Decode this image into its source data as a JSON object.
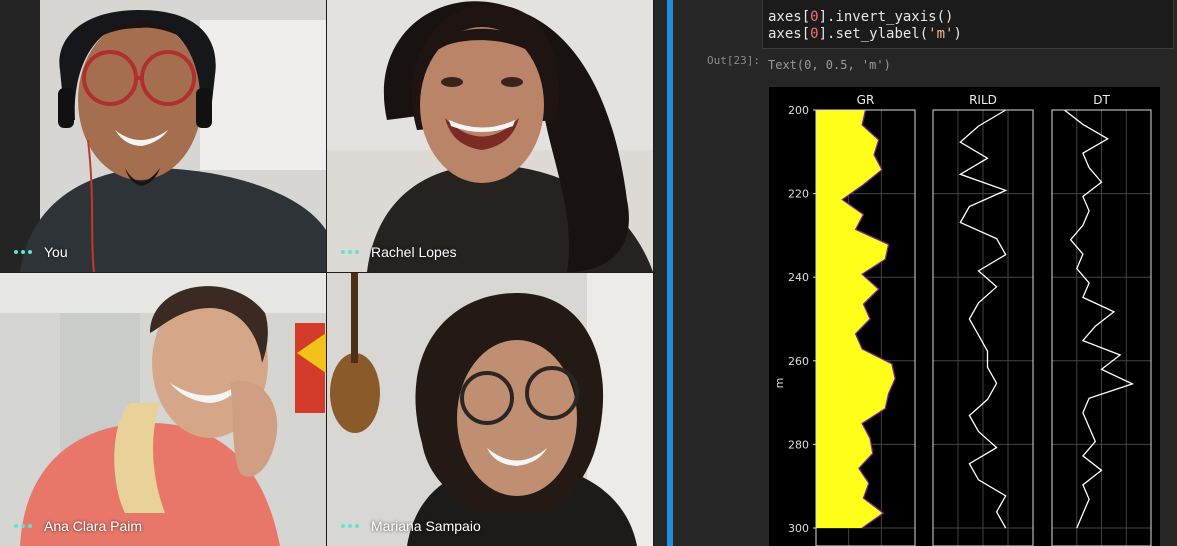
{
  "participants": [
    {
      "name": "You"
    },
    {
      "name": "Rachel Lopes"
    },
    {
      "name": "Ana Clara Paim"
    },
    {
      "name": "Mariana Sampaio"
    }
  ],
  "notebook": {
    "code_lines": [
      {
        "pre": "axes[",
        "num": "0",
        "post": "].invert_yaxis()"
      },
      {
        "pre": "axes[",
        "num": "0",
        "post": "].set_ylabel(",
        "str": "'m'",
        "end": ")"
      }
    ],
    "out_prompt": "Out[23]:",
    "out_text": "Text(0, 0.5, 'm')"
  },
  "chart_data": {
    "type": "line",
    "ylabel": "m",
    "ylim": [
      300,
      200
    ],
    "yticks": [
      "200",
      "220",
      "240",
      "260",
      "280",
      "300"
    ],
    "inverted_y": true,
    "grid": true,
    "panels": [
      {
        "title": "GR",
        "color": "#7b1fa2",
        "fill": "#ffff1a",
        "x": [
          75,
          70,
          95,
          88,
          100,
          72,
          40,
          72,
          60,
          110,
          105,
          70,
          95,
          72,
          82,
          60,
          70,
          115,
          120,
          110,
          105,
          70,
          82,
          86,
          65,
          80,
          72,
          102,
          70
        ]
      },
      {
        "title": "RILD",
        "color": "#ffffff",
        "x": [
          4.0,
          2.5,
          1.5,
          3.0,
          1.5,
          4.0,
          2.0,
          1.5,
          3.5,
          4.0,
          2.5,
          3.5,
          2.5,
          2.0,
          2.5,
          3.0,
          3.0,
          3.5,
          3.0,
          2.0,
          2.5,
          3.5,
          2.0,
          2.5,
          4.0,
          3.5,
          4.0
        ]
      },
      {
        "title": "DT",
        "color": "#ffffff",
        "x": [
          1.0,
          2.5,
          4.5,
          2.5,
          3.0,
          4.0,
          2.5,
          3.0,
          2.5,
          1.5,
          2.5,
          2.0,
          3.0,
          2.5,
          5.0,
          3.5,
          2.5,
          5.5,
          4.0,
          6.5,
          3.0,
          2.5,
          3.0,
          3.5,
          2.5,
          4.0,
          2.5,
          3.0,
          2.5,
          2.0
        ]
      }
    ]
  }
}
